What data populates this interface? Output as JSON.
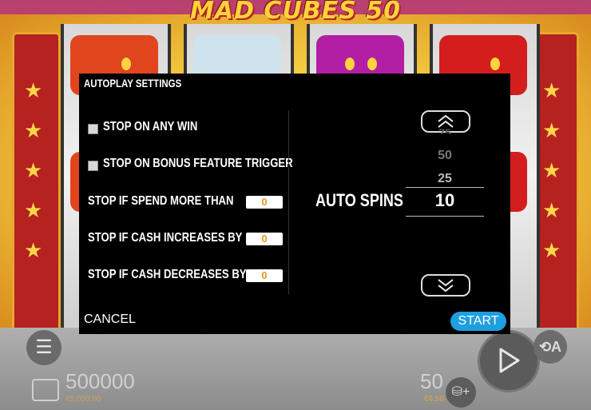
{
  "game": {
    "logo_text": "MAD CUBES 50"
  },
  "dialog": {
    "title": "AUTOPLAY SETTINGS",
    "stop_any_win": {
      "label": "STOP ON ANY WIN",
      "checked": false
    },
    "stop_bonus": {
      "label": "STOP ON BONUS FEATURE TRIGGER",
      "checked": false
    },
    "spend_more": {
      "label": "STOP IF SPEND MORE THAN",
      "value": "0"
    },
    "cash_increase": {
      "label": "STOP IF CASH INCREASES BY",
      "value": "0"
    },
    "cash_decrease": {
      "label": "STOP IF CASH DECREASES BY",
      "value": "0"
    },
    "auto_spins": {
      "label": "AUTO SPINS",
      "above_options": [
        "75",
        "50",
        "25"
      ],
      "selected": "10"
    },
    "cancel_label": "CANCEL",
    "start_label": "START"
  },
  "footer": {
    "balance": "500000",
    "balance_money": "€5,000.00",
    "bet": "50",
    "bet_money": "€0.50"
  },
  "colors": {
    "dialog_bg": "#000000",
    "start_button": "#1e9fe0",
    "input_value": "#e09c22",
    "money_text": "#c8a25a"
  },
  "icons": {
    "menu": "hamburger-icon",
    "play": "play-icon",
    "autoplay": "autoplay-icon",
    "wallet": "wallet-icon",
    "coins": "coins-plus-icon",
    "picker_up": "double-chevron-up-icon",
    "picker_down": "double-chevron-down-icon"
  }
}
